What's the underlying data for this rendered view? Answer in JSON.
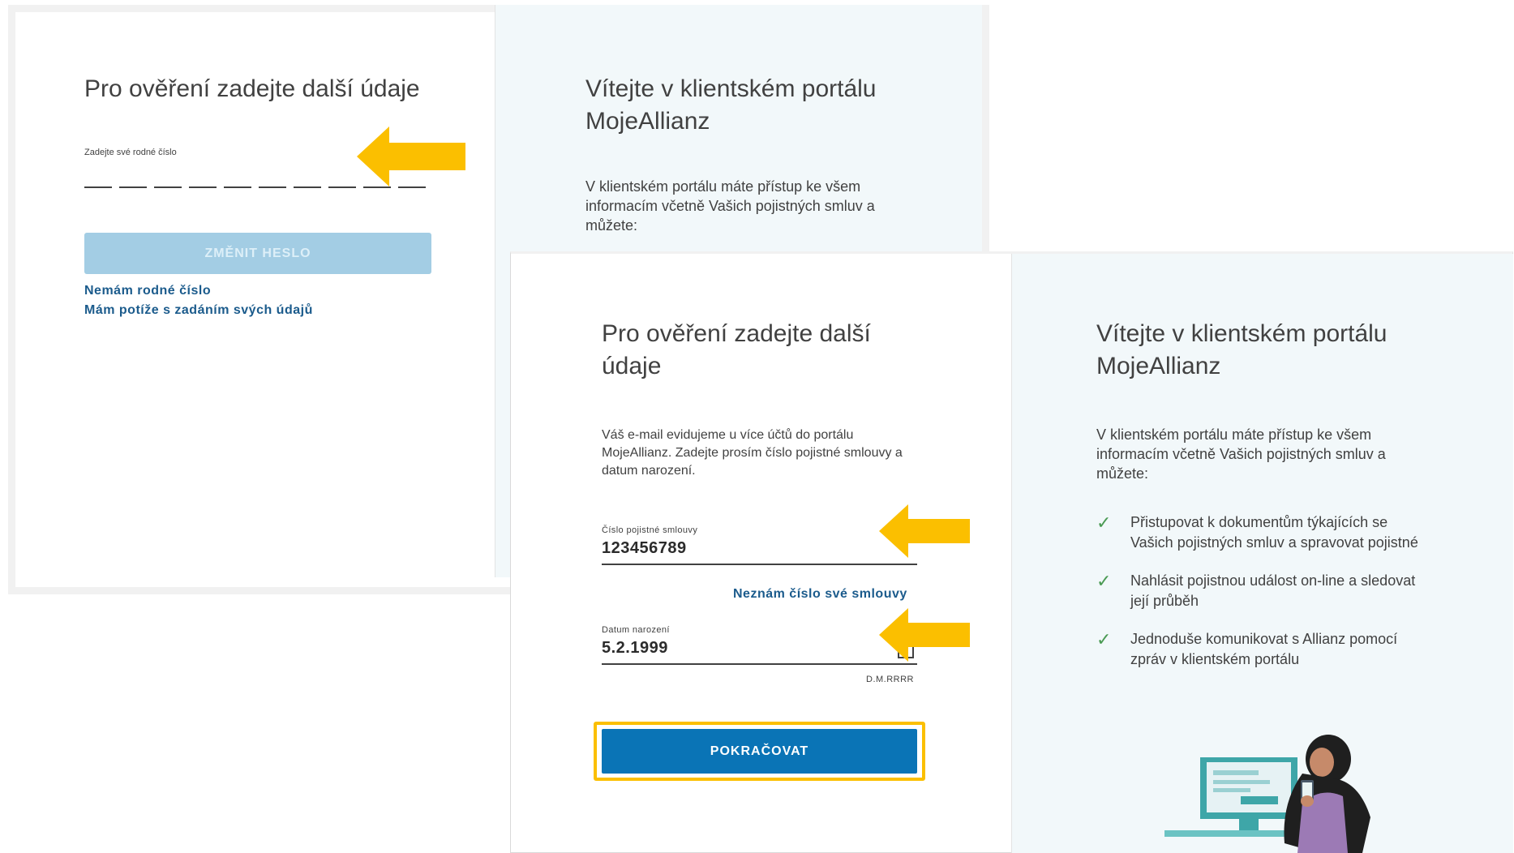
{
  "screen1": {
    "title": "Pro ověření zadejte další údaje",
    "rc_label": "Zadejte své rodné číslo",
    "button_label": "ZMĚNIT HESLO",
    "link_no_rc": "Nemám rodné číslo",
    "link_trouble": "Mám potíže s zadáním svých údajů",
    "welcome_title": "Vítejte v klientském portálu MojeAllianz",
    "welcome_intro": "V klientském portálu máte přístup ke všem informacím včetně Vašich pojistných smluv a můžete:"
  },
  "screen2": {
    "title": "Pro ověření zadejte další údaje",
    "description": "Váš e-mail evidujeme u více účtů do portálu MojeAllianz. Zadejte prosím číslo pojistné smlouvy a datum narození.",
    "policy_label": "Číslo pojistné smlouvy",
    "policy_value": "123456789",
    "policy_link": "Neznám číslo své smlouvy",
    "dob_label": "Datum narození",
    "dob_value": "5.2.1999",
    "dob_hint": "D.M.RRRR",
    "button_label": "POKRAČOVAT",
    "welcome_title": "Vítejte v klientském portálu MojeAllianz",
    "welcome_intro": "V klientském portálu máte přístup ke všem informacím včetně Vašich pojistných smluv a můžete:",
    "benefits": [
      "Přistupovat k dokumentům týkajících se Vašich pojistných smluv a spravovat pojistné",
      "Nahlásit pojistnou událost on-line a sledovat její průběh",
      "Jednoduše komunikovat s Allianz pomocí zpráv v klientském portálu"
    ]
  },
  "colors": {
    "accent_arrow": "#fbbf00",
    "primary_button": "#0a74b6",
    "disabled_button": "#a3cde4",
    "link": "#1b5b8c",
    "panel_bg": "#f2f8fa",
    "check": "#4a9a53"
  },
  "icons": [
    "arrow-left-icon",
    "calendar-icon",
    "check-icon",
    "woman-with-phone-illustration"
  ]
}
